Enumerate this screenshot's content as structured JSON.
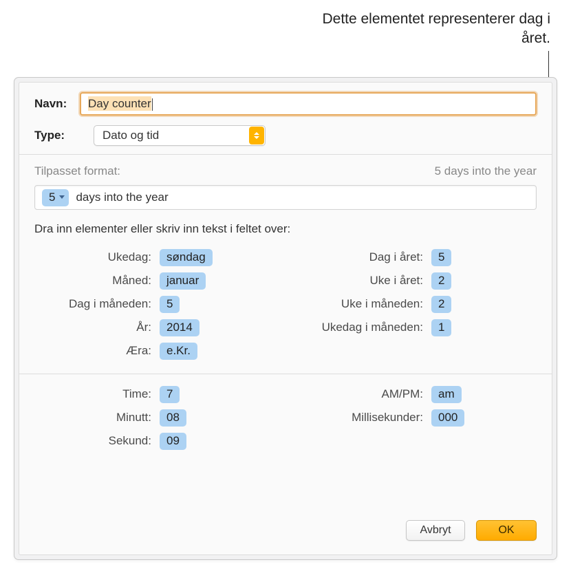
{
  "annotation": "Dette elementet representerer dag i året.",
  "labels": {
    "name": "Navn:",
    "type": "Type:",
    "custom_format": "Tilpasset format:",
    "preview": "5 days into the year",
    "instruction": "Dra inn elementer eller skriv inn tekst i feltet over:"
  },
  "name_value": "Day counter",
  "type_value": "Dato og tid",
  "format_field": {
    "token_value": "5",
    "suffix_text": "days into the year"
  },
  "left_col": [
    {
      "label": "Ukedag:",
      "value": "søndag"
    },
    {
      "label": "Måned:",
      "value": "januar"
    },
    {
      "label": "Dag i måneden:",
      "value": "5"
    },
    {
      "label": "År:",
      "value": "2014"
    },
    {
      "label": "Æra:",
      "value": "e.Kr."
    }
  ],
  "right_col": [
    {
      "label": "Dag i året:",
      "value": "5"
    },
    {
      "label": "Uke i året:",
      "value": "2"
    },
    {
      "label": "Uke i måneden:",
      "value": "2"
    },
    {
      "label": "Ukedag i måneden:",
      "value": "1"
    }
  ],
  "time_left": [
    {
      "label": "Time:",
      "value": "7"
    },
    {
      "label": "Minutt:",
      "value": "08"
    },
    {
      "label": "Sekund:",
      "value": "09"
    }
  ],
  "time_right": [
    {
      "label": "AM/PM:",
      "value": "am"
    },
    {
      "label": "Millisekunder:",
      "value": "000"
    }
  ],
  "buttons": {
    "cancel": "Avbryt",
    "ok": "OK"
  }
}
